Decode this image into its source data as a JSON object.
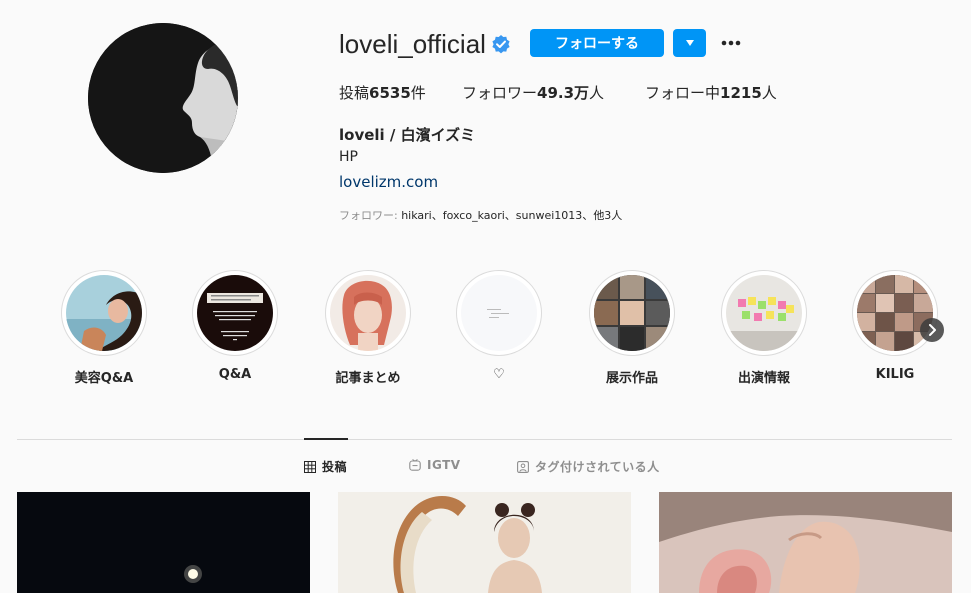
{
  "profile": {
    "username": "loveli_official",
    "follow_label": "フォローする",
    "fullname": "loveli / 白濱イズミ",
    "category": "HP",
    "website": "lovelizm.com",
    "followed_by_prefix": "フォロワー: ",
    "followed_by_names": "hikari、foxco_kaori、sunwei1013、",
    "followed_by_suffix": "他3人"
  },
  "stats": {
    "posts_label": "投稿",
    "posts_value": "6535",
    "posts_unit": "件",
    "followers_label": "フォロワー",
    "followers_value": "49.3万",
    "followers_unit": "人",
    "following_label": "フォロー中",
    "following_value": "1215",
    "following_unit": "人"
  },
  "highlights": [
    {
      "label": "美容Q&A"
    },
    {
      "label": "Q&A"
    },
    {
      "label": "記事まとめ"
    },
    {
      "label": "♡"
    },
    {
      "label": "展示作品"
    },
    {
      "label": "出演情報"
    },
    {
      "label": "KILIG"
    }
  ],
  "tabs": [
    {
      "label": "投稿",
      "icon": "grid-icon",
      "active": true
    },
    {
      "label": "IGTV",
      "icon": "igtv-icon",
      "active": false
    },
    {
      "label": "タグ付けされている人",
      "icon": "tagged-icon",
      "active": false
    }
  ],
  "colors": {
    "primary_button": "#0095f6",
    "link": "#00376b",
    "background": "#fafafa"
  }
}
